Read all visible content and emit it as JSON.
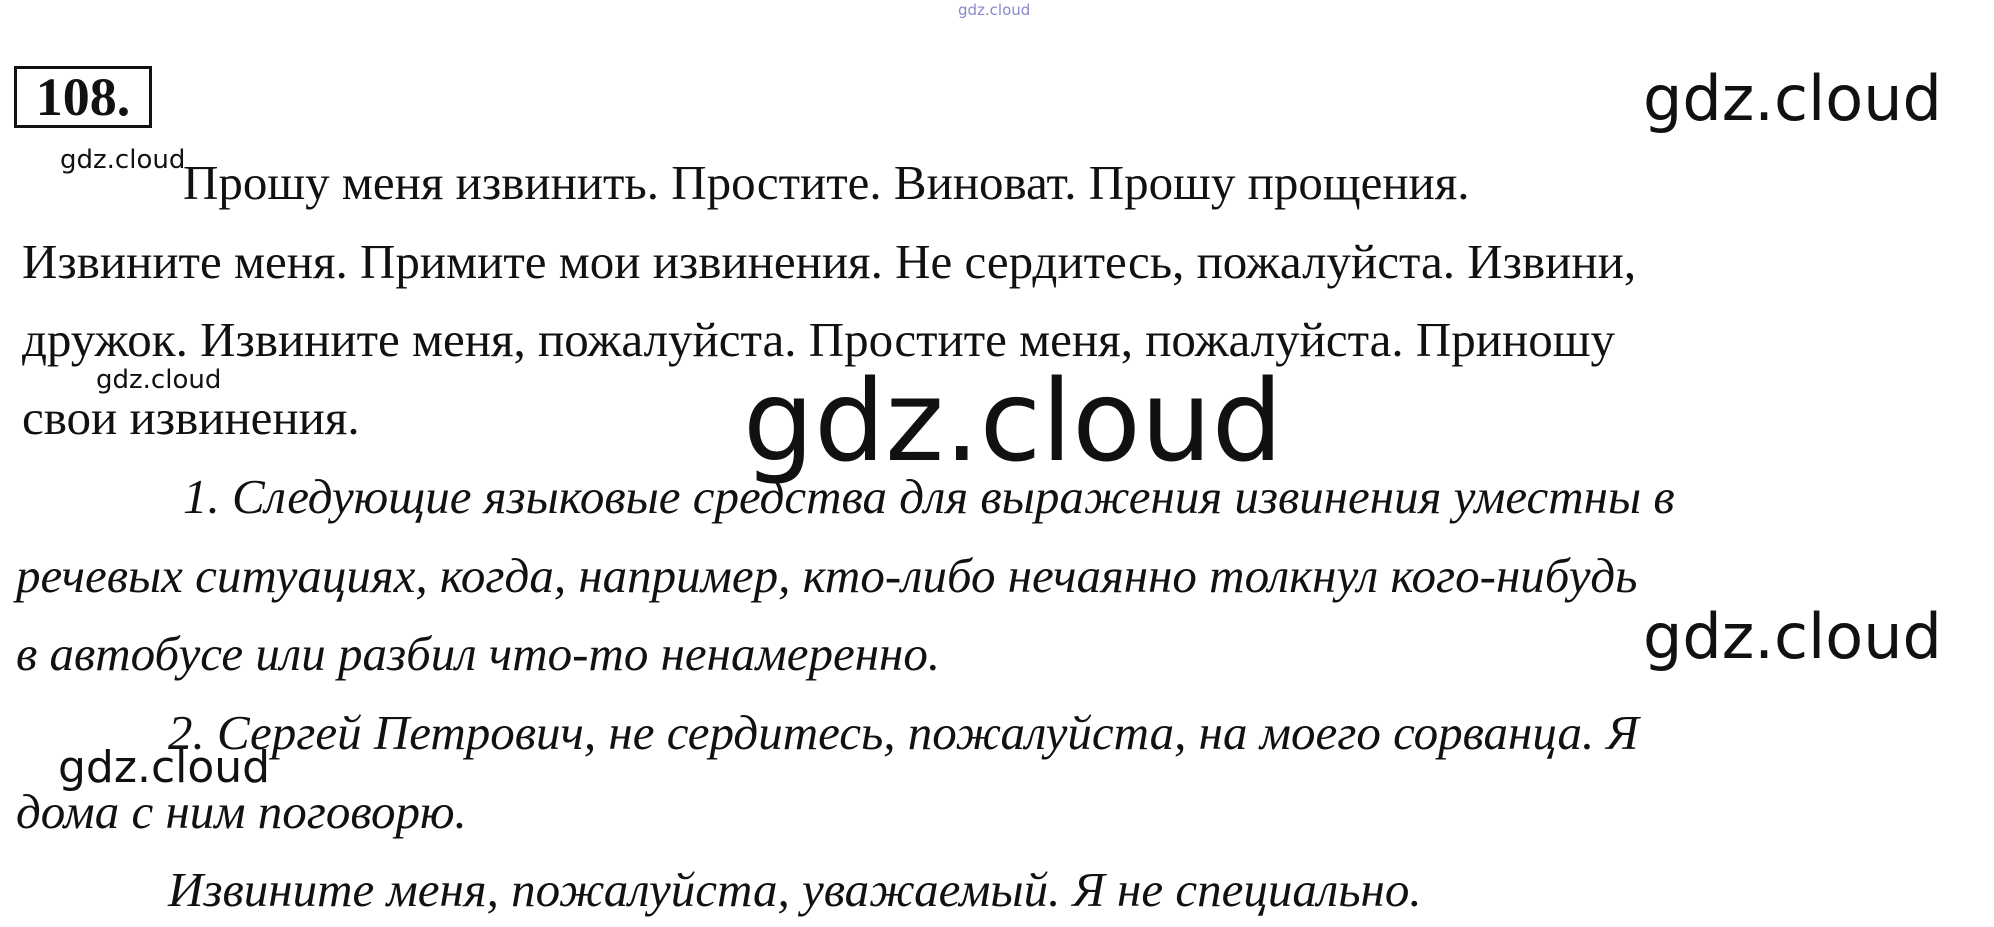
{
  "watermarks": {
    "top": "gdz.cloud",
    "right_top": "gdz.cloud",
    "left_small_1": "gdz.cloud",
    "left_small_2": "gdz.cloud",
    "center_large": "gdz.cloud",
    "right_middle": "gdz.cloud",
    "left_bottom": "gdz.cloud"
  },
  "exercise_number": "108.",
  "lines": [
    "Прошу меня извинить. Простите. Виноват. Прошу прощения.",
    "Извините меня. Примите мои извинения. Не сердитесь, пожалуйста. Извини,",
    "дружок. Извините меня, пожалуйста. Простите меня, пожалуйста. Приношу",
    "свои извинения.",
    "1. Следующие языковые средства для выражения извинения уместны в",
    "речевых ситуациях, когда, например, кто-либо нечаянно толкнул кого-нибудь",
    "в автобусе или разбил что-то ненамеренно.",
    "2. Сергей Петрович, не сердитесь, пожалуйста, на моего сорванца. Я",
    "дома с ним поговорю.",
    "Извините меня, пожалуйста, уважаемый. Я не специально."
  ]
}
